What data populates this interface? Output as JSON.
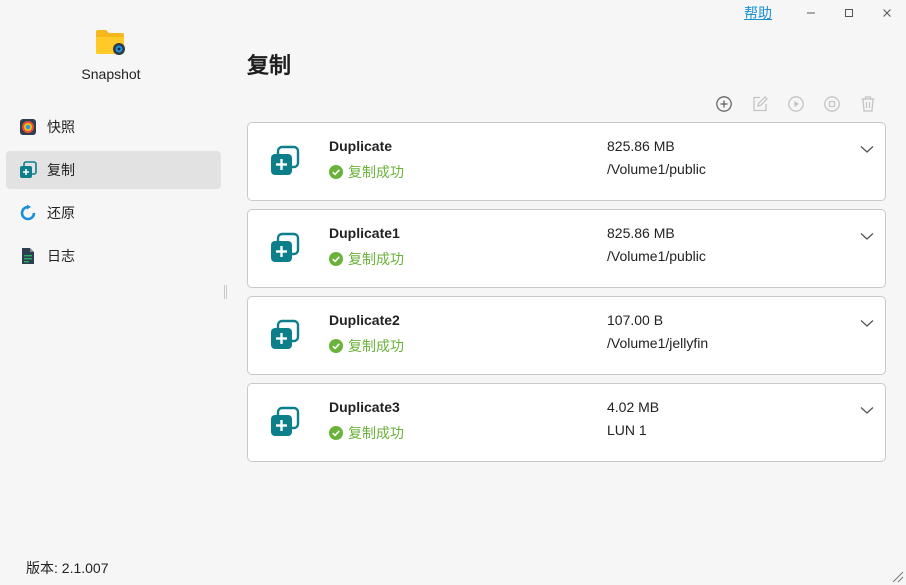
{
  "titlebar": {
    "help_label": "帮助"
  },
  "app": {
    "name": "Snapshot",
    "icon": "folder-snapshot-icon"
  },
  "sidebar": {
    "items": [
      {
        "label": "快照",
        "icon": "snapshot-icon",
        "active": false
      },
      {
        "label": "复制",
        "icon": "duplicate-icon",
        "active": true
      },
      {
        "label": "还原",
        "icon": "restore-icon",
        "active": false
      },
      {
        "label": "日志",
        "icon": "log-icon",
        "active": false
      }
    ],
    "version": "版本: 2.1.007"
  },
  "main": {
    "title": "复制",
    "toolbar": [
      "add-icon",
      "edit-icon",
      "play-icon",
      "stop-icon",
      "trash-icon"
    ],
    "tasks": [
      {
        "name": "Duplicate",
        "status": "复制成功",
        "size": "825.86 MB",
        "path": "/Volume1/public"
      },
      {
        "name": "Duplicate1",
        "status": "复制成功",
        "size": "825.86 MB",
        "path": "/Volume1/public"
      },
      {
        "name": "Duplicate2",
        "status": "复制成功",
        "size": "107.00 B",
        "path": "/Volume1/jellyfin"
      },
      {
        "name": "Duplicate3",
        "status": "复制成功",
        "size": "4.02 MB",
        "path": "LUN 1"
      }
    ]
  },
  "colors": {
    "accent": "#0d7f8a",
    "success": "#6bb23a",
    "link": "#1a8fd8",
    "active_bg": "#e2e2e2"
  }
}
